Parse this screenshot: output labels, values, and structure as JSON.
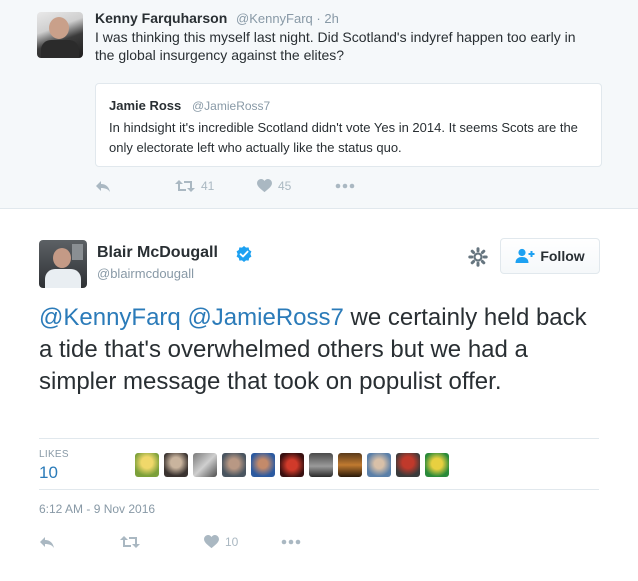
{
  "parent_tweet": {
    "name": "Kenny Farquharson",
    "handle": "@KennyFarq",
    "time": "· 2h",
    "text": "I was thinking this myself last night. Did Scotland's indyref happen too early in the global insurgency against the elites?",
    "quote": {
      "name": "Jamie Ross",
      "handle": "@JamieRoss7",
      "text": "In hindsight it's incredible Scotland didn't vote Yes in 2014. It seems Scots are the only electorate left who actually like the status quo."
    },
    "actions": {
      "retweets": "41",
      "likes": "45"
    }
  },
  "main_tweet": {
    "name": "Blair McDougall",
    "handle": "@blairmcdougall",
    "follow_label": "Follow",
    "mention_1": "@KennyFarq",
    "mention_2": "@JamieRoss7",
    "text": " we certainly held back a tide that's overwhelmed others but we had a simpler message that took on populist offer.",
    "likes_label": "LIKES",
    "likes_count": "10",
    "timestamp": "6:12 AM - 9 Nov 2016",
    "actions": {
      "likes": "10"
    }
  },
  "colors": {
    "link": "#2b7bb9",
    "muted": "#8899a6",
    "icon": "#aab8c2",
    "verified": "#1da1f2",
    "border": "#e1e8ed",
    "parent_bg": "#f5f8fa"
  },
  "icons": [
    "reply-icon",
    "retweet-icon",
    "heart-icon",
    "more-icon",
    "gear-icon",
    "follow-person-icon",
    "verified-icon"
  ]
}
